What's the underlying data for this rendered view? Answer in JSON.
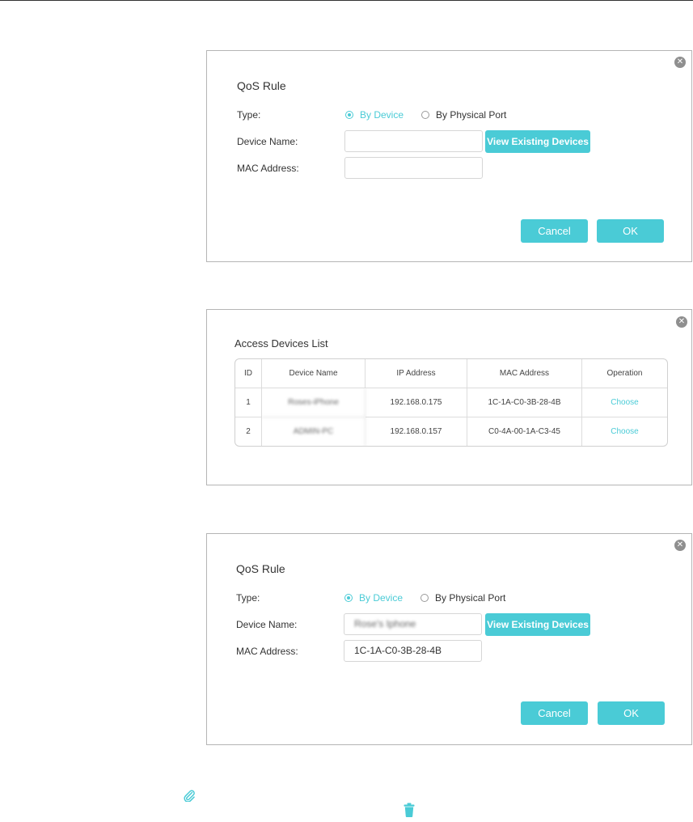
{
  "colors": {
    "accent": "#4acbd6",
    "border": "#b5b5b5",
    "close": "#8f8f8f"
  },
  "panels": [
    {
      "title": "QoS Rule",
      "type_label": "Type:",
      "options": [
        "By Device",
        "By Physical Port"
      ],
      "device_name_label": "Device Name:",
      "device_name_value": "",
      "mac_label": "MAC Address:",
      "mac_value": "",
      "view_button": "View Existing Devices",
      "cancel": "Cancel",
      "ok": "OK"
    },
    {
      "title": "Access Devices List",
      "columns": [
        "ID",
        "Device Name",
        "IP Address",
        "MAC Address",
        "Operation"
      ],
      "rows": [
        {
          "id": "1",
          "name": "Roses-iPhone",
          "ip": "192.168.0.175",
          "mac": "1C-1A-C0-3B-28-4B",
          "op": "Choose"
        },
        {
          "id": "2",
          "name": "ADMIN-PC",
          "ip": "192.168.0.157",
          "mac": "C0-4A-00-1A-C3-45",
          "op": "Choose"
        }
      ]
    },
    {
      "title": "QoS Rule",
      "type_label": "Type:",
      "options": [
        "By Device",
        "By Physical Port"
      ],
      "device_name_label": "Device Name:",
      "device_name_value": "Rose's Iphone",
      "mac_label": "MAC Address:",
      "mac_value": "1C-1A-C0-3B-28-4B",
      "view_button": "View Existing Devices",
      "cancel": "Cancel",
      "ok": "OK"
    }
  ],
  "icons": {
    "close": "close-icon",
    "attachment": "paperclip-icon",
    "delete": "trash-icon"
  }
}
